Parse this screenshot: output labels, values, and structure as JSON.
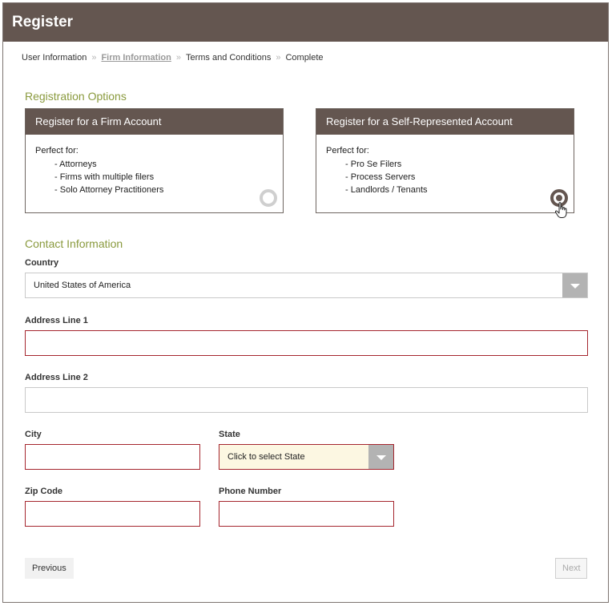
{
  "header": {
    "title": "Register"
  },
  "breadcrumb": {
    "items": [
      "User Information",
      "Firm Information",
      "Terms and Conditions",
      "Complete"
    ],
    "separator": "»",
    "active_index": 1
  },
  "registration": {
    "section_title": "Registration Options",
    "options": [
      {
        "title": "Register for a Firm Account",
        "intro": "Perfect for:",
        "items": [
          "Attorneys",
          "Firms with multiple filers",
          "Solo Attorney Practitioners"
        ],
        "selected": false
      },
      {
        "title": "Register for a Self-Represented Account",
        "intro": "Perfect for:",
        "items": [
          "Pro Se Filers",
          "Process Servers",
          "Landlords / Tenants"
        ],
        "selected": true
      }
    ]
  },
  "contact": {
    "section_title": "Contact Information",
    "country": {
      "label": "Country",
      "value": "United States of America"
    },
    "address1": {
      "label": "Address Line 1",
      "value": ""
    },
    "address2": {
      "label": "Address Line 2",
      "value": ""
    },
    "city": {
      "label": "City",
      "value": ""
    },
    "state": {
      "label": "State",
      "value": "Click to select State"
    },
    "zip": {
      "label": "Zip Code",
      "value": ""
    },
    "phone": {
      "label": "Phone Number",
      "value": ""
    }
  },
  "buttons": {
    "previous": "Previous",
    "next": "Next"
  },
  "colors": {
    "header_bg": "#645650",
    "section_title": "#8a9a3e",
    "invalid_border": "#a5262e",
    "state_bg": "#fcf7e2"
  }
}
